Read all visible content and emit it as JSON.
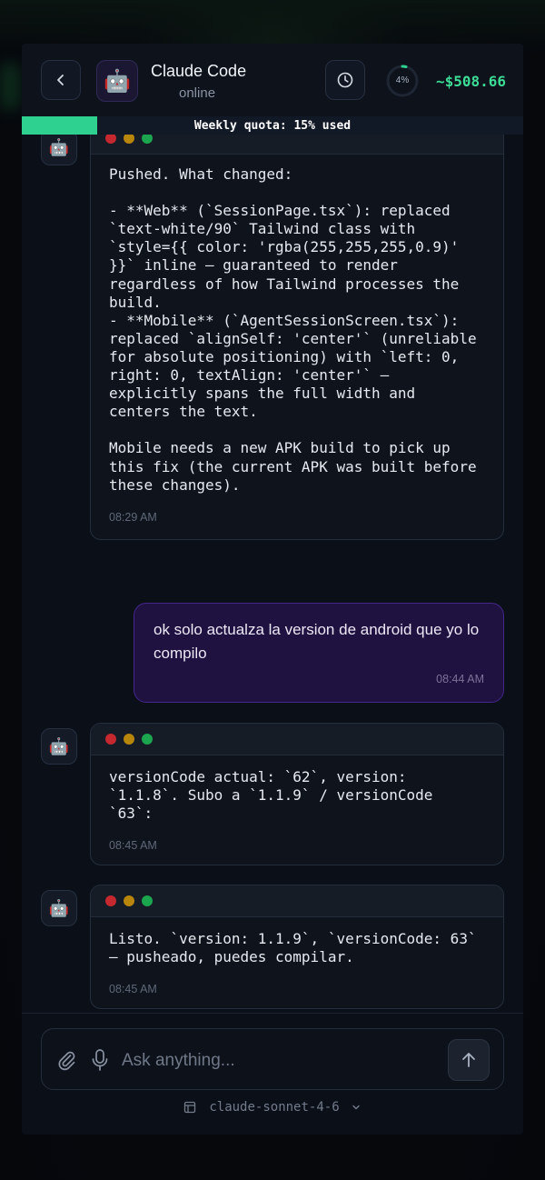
{
  "header": {
    "agent_name": "Claude Code",
    "agent_status": "online",
    "agent_avatar": "🤖",
    "progress_label": "4%",
    "progress_value": 0.04,
    "cost": "~$508.66"
  },
  "quota": {
    "label": "Weekly quota: 15% used",
    "fraction": 0.15
  },
  "messages": {
    "m1": {
      "text": "Pushed. What changed:\n\n- **Web** (`SessionPage.tsx`): replaced `text-white/90` Tailwind class with `style={{ color: 'rgba(255,255,255,0.9)' }}` inline — guaranteed to render regardless of how Tailwind processes the build.\n- **Mobile** (`AgentSessionScreen.tsx`): replaced `alignSelf: 'center'` (unreliable for absolute positioning) with `left: 0, right: 0, textAlign: 'center'` — explicitly spans the full width and centers the text.\n\nMobile needs a new APK build to pick up this fix (the current APK was built before these changes).",
      "time": "08:29 AM"
    },
    "m2": {
      "text": "ok solo actualza la version de android que yo lo compilo",
      "time": "08:44 AM"
    },
    "m3": {
      "text": "versionCode actual: `62`, version: `1.1.8`. Subo a `1.1.9` / versionCode `63`:",
      "time": "08:45 AM"
    },
    "m4": {
      "text": "Listo. `version: 1.1.9`, `versionCode: 63` — pusheado, puedes compilar.",
      "time": "08:45 AM"
    }
  },
  "composer": {
    "placeholder": "Ask anything...",
    "model": "claude-sonnet-4-6"
  },
  "colors": {
    "accent_green": "#2fd190",
    "cost_green": "#3ddc97",
    "user_bubble": "#1f1140",
    "panel": "#0b0f17"
  },
  "icons": [
    "chevron-left-icon",
    "robot-icon",
    "clock-icon",
    "paperclip-icon",
    "microphone-icon",
    "arrow-up-icon",
    "model-icon",
    "chevron-down-icon"
  ]
}
